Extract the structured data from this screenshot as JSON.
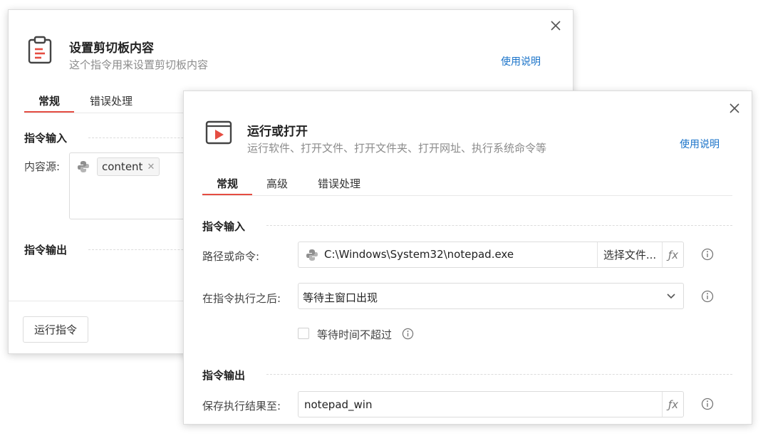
{
  "back_dialog": {
    "title": "设置剪切板内容",
    "subtitle": "这个指令用来设置剪切板内容",
    "help_link": "使用说明",
    "tabs": [
      {
        "label": "常规"
      },
      {
        "label": "错误处理"
      }
    ],
    "input_section": "指令输入",
    "content_source_label": "内容源:",
    "content_tag": "content",
    "output_section": "指令输出",
    "run_button": "运行指令"
  },
  "front_dialog": {
    "title": "运行或打开",
    "subtitle": "运行软件、打开文件、打开文件夹、打开网址、执行系统命令等",
    "help_link": "使用说明",
    "tabs": [
      {
        "label": "常规"
      },
      {
        "label": "高级"
      },
      {
        "label": "错误处理"
      }
    ],
    "input_section": "指令输入",
    "path_label": "路径或命令:",
    "path_value": "C:\\Windows\\System32\\notepad.exe",
    "select_file_button": "选择文件...",
    "fx_label": "ƒx",
    "after_exec_label": "在指令执行之后:",
    "after_exec_value": "等待主窗口出现",
    "wait_timeout_label": "等待时间不超过",
    "output_section": "指令输出",
    "save_result_label": "保存执行结果至:",
    "save_result_value": "notepad_win"
  },
  "colors": {
    "accent": "#e54d42",
    "link": "#1a73c9"
  }
}
